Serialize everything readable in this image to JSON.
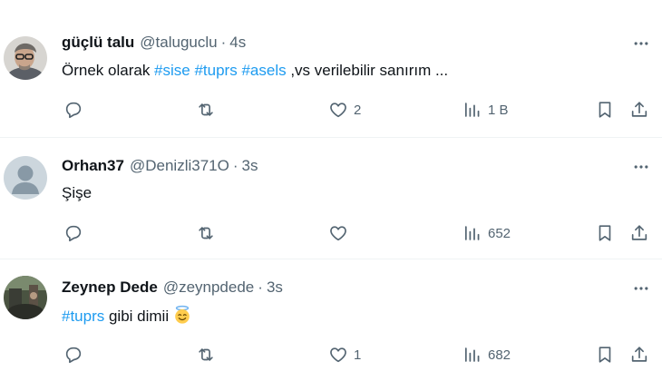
{
  "tweets": [
    {
      "name": "güçlü talu",
      "handle": "@taluguclu",
      "dot": "·",
      "time": "4s",
      "text_before": "Örnek olarak ",
      "hashtags": [
        "#sise",
        "#tuprs",
        "#asels"
      ],
      "text_after": " ,vs verilebilir sanırım ...",
      "reply_count": "",
      "retweet_count": "",
      "like_count": "2",
      "view_count": "1 B"
    },
    {
      "name": "Orhan37",
      "handle": "@Denizli371O",
      "dot": "·",
      "time": "3s",
      "text": "Şişe",
      "like_count": "",
      "view_count": "652"
    },
    {
      "name": "Zeynep Dede",
      "handle": "@zeynpdede",
      "dot": "·",
      "time": "3s",
      "hashtag": "#tuprs",
      "text": " gibi dimii",
      "emoji": "smiling-face-with-halo",
      "like_count": "1",
      "view_count": "682"
    }
  ],
  "colors": {
    "link": "#1d9bf0",
    "muted": "#536471",
    "text": "#0f1419",
    "divider": "#eff3f4"
  },
  "icons": [
    "reply-icon",
    "retweet-icon",
    "like-icon",
    "views-icon",
    "bookmark-icon",
    "share-icon",
    "more-icon"
  ]
}
